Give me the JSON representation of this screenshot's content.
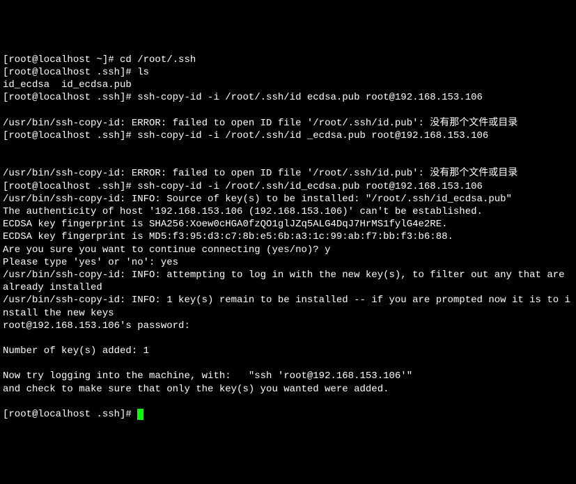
{
  "lines": [
    "[root@localhost ~]# cd /root/.ssh",
    "[root@localhost .ssh]# ls",
    "id_ecdsa  id_ecdsa.pub",
    "[root@localhost .ssh]# ssh-copy-id -i /root/.ssh/id ecdsa.pub root@192.168.153.106",
    "",
    "/usr/bin/ssh-copy-id: ERROR: failed to open ID file '/root/.ssh/id.pub': 没有那个文件或目录",
    "[root@localhost .ssh]# ssh-copy-id -i /root/.ssh/id _ecdsa.pub root@192.168.153.106",
    "",
    "",
    "/usr/bin/ssh-copy-id: ERROR: failed to open ID file '/root/.ssh/id.pub': 没有那个文件或目录",
    "[root@localhost .ssh]# ssh-copy-id -i /root/.ssh/id_ecdsa.pub root@192.168.153.106",
    "/usr/bin/ssh-copy-id: INFO: Source of key(s) to be installed: \"/root/.ssh/id_ecdsa.pub\"",
    "The authenticity of host '192.168.153.106 (192.168.153.106)' can't be established.",
    "ECDSA key fingerprint is SHA256:Xoew0cHGA0fzQO1glJZq5ALG4DqJ7HrMS1fylG4e2RE.",
    "ECDSA key fingerprint is MD5:f3:95:d3:c7:8b:e5:6b:a3:1c:99:ab:f7:bb:f3:b6:88.",
    "Are you sure you want to continue connecting (yes/no)? y",
    "Please type 'yes' or 'no': yes",
    "/usr/bin/ssh-copy-id: INFO: attempting to log in with the new key(s), to filter out any that are already installed",
    "/usr/bin/ssh-copy-id: INFO: 1 key(s) remain to be installed -- if you are prompted now it is to install the new keys",
    "root@192.168.153.106's password:",
    "",
    "Number of key(s) added: 1",
    "",
    "Now try logging into the machine, with:   \"ssh 'root@192.168.153.106'\"",
    "and check to make sure that only the key(s) you wanted were added.",
    ""
  ],
  "prompt": "[root@localhost .ssh]# "
}
